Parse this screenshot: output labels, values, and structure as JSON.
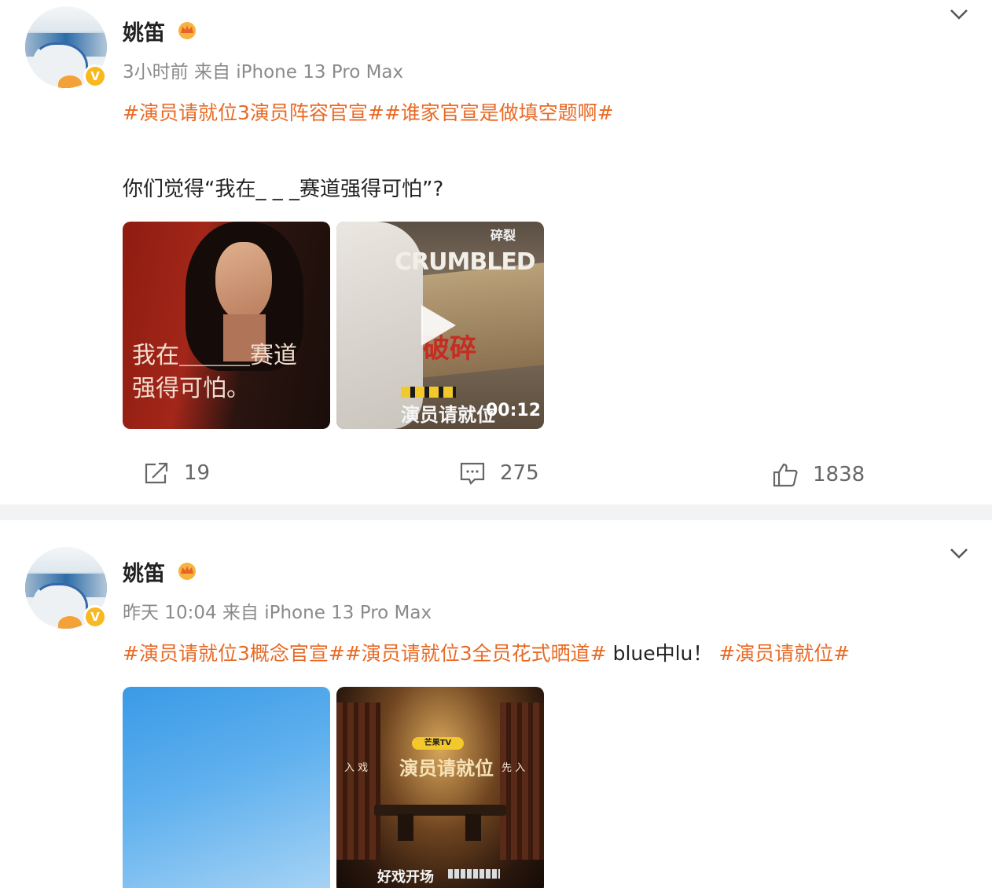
{
  "posts": [
    {
      "username": "姚笛",
      "meta": "3小时前  来自 iPhone 13 Pro Max",
      "topics": [
        "#演员请就位3演员阵容官宣#",
        "#谁家官宣是做填空题啊#"
      ],
      "body": "你们觉得“我在_ _ _赛道强得可怕”?",
      "image1": {
        "caption_line1": "我在＿＿＿赛道",
        "caption_line2": "强得可怕。"
      },
      "video": {
        "word": "CRUMBLED",
        "top_text": "碎裂",
        "red_text": "破碎",
        "show_name": "演员请就位",
        "duration": "00:12"
      },
      "actions": {
        "repost": "19",
        "comment": "275",
        "like": "1838"
      }
    },
    {
      "username": "姚笛",
      "meta": "昨天 10:04  来自 iPhone 13 Pro Max",
      "topics_line": {
        "tag1": "#演员请就位3概念官宣#",
        "tag2": "#演员请就位3全员花式晒道#",
        "plain": " blue中lu！",
        "tag3": "#演员请就位#"
      },
      "image2": {
        "badge": "芒果TV",
        "title": "演员请就位",
        "side_left": "入  戏",
        "side_right": "先  入",
        "bottom": "好戏开场"
      }
    }
  ],
  "colors": {
    "tag": "#e86a25",
    "meta": "#8a8a8a",
    "badge": "#f8b81f"
  },
  "icons": [
    "verified-badge-icon",
    "crown-icon",
    "chevron-down-icon",
    "repost-icon",
    "comment-icon",
    "like-icon",
    "play-icon"
  ]
}
